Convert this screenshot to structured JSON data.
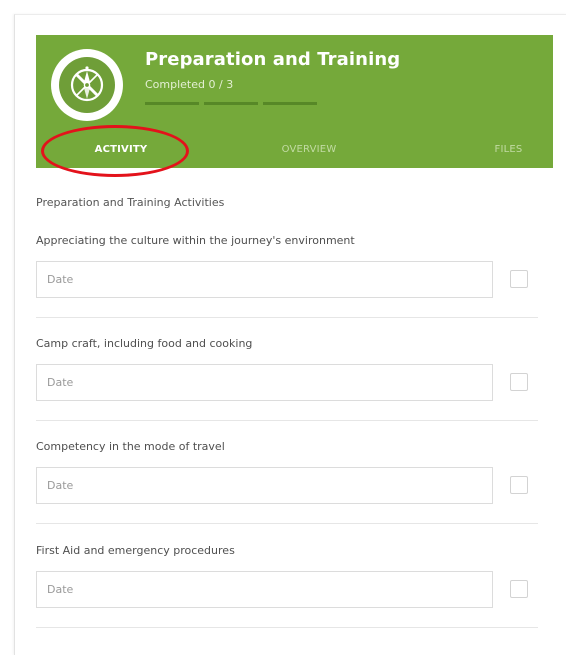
{
  "header": {
    "title": "Preparation and Training",
    "completed_text": "Completed 0 / 3",
    "background_color": "#75a93a",
    "badge_icon": "compass-icon",
    "progress_completed": 0,
    "progress_total": 3
  },
  "tabs": [
    {
      "label": "ACTIVITY",
      "active": true
    },
    {
      "label": "OVERVIEW",
      "active": false
    },
    {
      "label": "FILES",
      "active": false
    }
  ],
  "annotation": {
    "highlight_color": "#e3121b",
    "highlighted_tab": "ACTIVITY"
  },
  "section": {
    "title": "Preparation and Training Activities"
  },
  "activities": [
    {
      "label": "Appreciating the culture within the journey's environment",
      "date_placeholder": "Date",
      "checked": false
    },
    {
      "label": "Camp craft, including food and cooking",
      "date_placeholder": "Date",
      "checked": false
    },
    {
      "label": "Competency in the mode of travel",
      "date_placeholder": "Date",
      "checked": false
    },
    {
      "label": "First Aid and emergency procedures",
      "date_placeholder": "Date",
      "checked": false
    }
  ]
}
